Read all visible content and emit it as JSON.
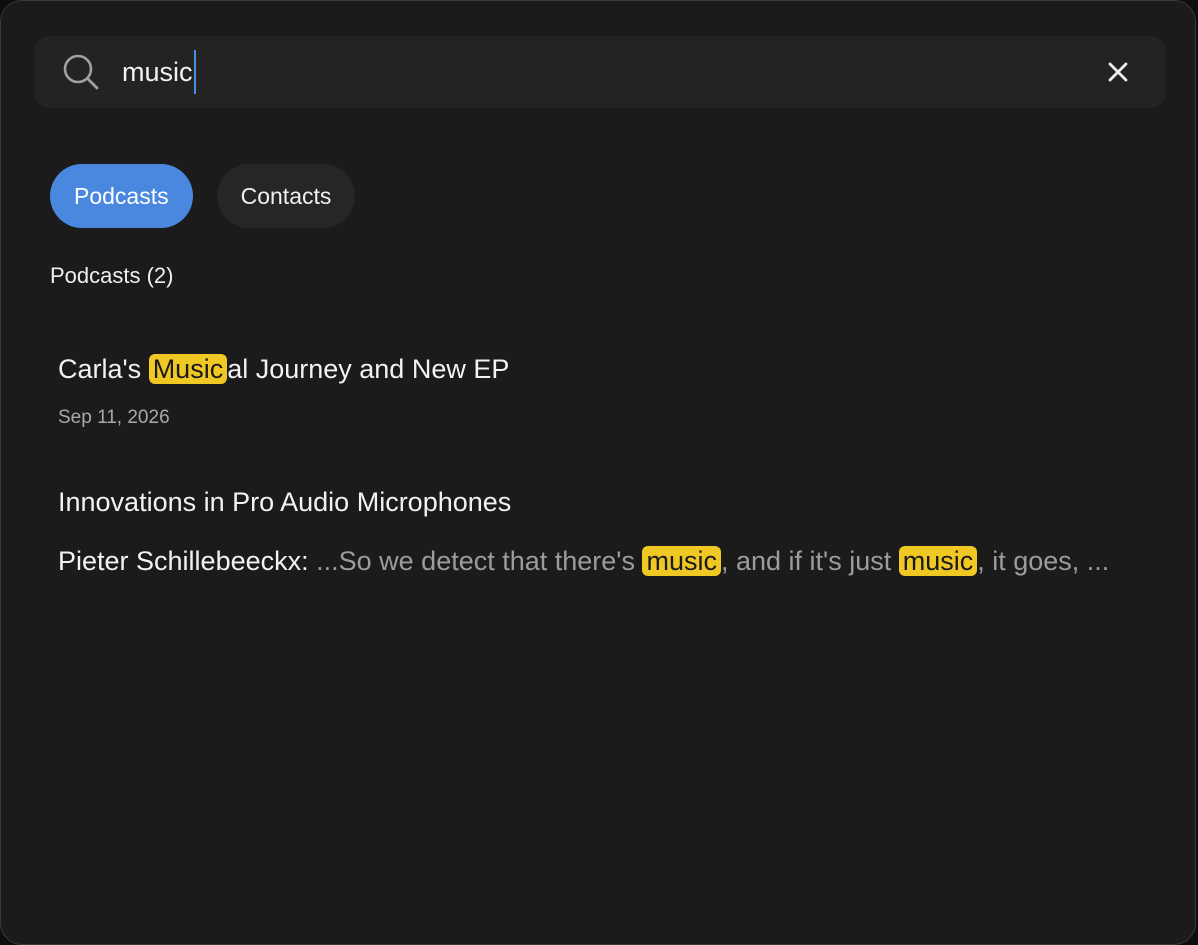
{
  "search": {
    "value": "music",
    "clear_label": "×"
  },
  "tabs": [
    {
      "label": "Podcasts",
      "active": true
    },
    {
      "label": "Contacts",
      "active": false
    }
  ],
  "section": {
    "title": "Podcasts (2)"
  },
  "results": [
    {
      "title_before": "Carla's ",
      "title_match": "Music",
      "title_after": "al Journey and New EP",
      "date": "Sep 11, 2026"
    },
    {
      "title": "Innovations in Pro Audio Microphones",
      "speaker": "Pieter Schillebeeckx:",
      "snippet_1": " ...So we detect that there's ",
      "match_1": "music",
      "snippet_2": ", and if it's just ",
      "match_2": "music",
      "snippet_3": ", it goes, ..."
    }
  ],
  "colors": {
    "accent": "#4a88e0",
    "highlight": "#f0c824",
    "background": "#1b1b1b"
  },
  "icons": {
    "search": "search-icon",
    "clear": "close-icon"
  }
}
